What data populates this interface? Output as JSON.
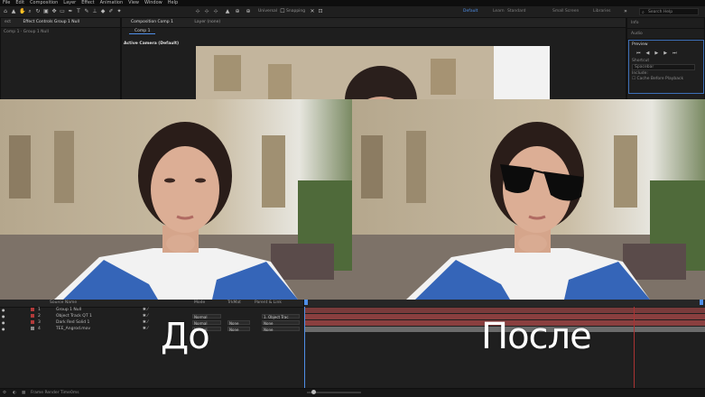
{
  "menu": [
    "File",
    "Edit",
    "Composition",
    "Layer",
    "Effect",
    "Animation",
    "View",
    "Window",
    "Help"
  ],
  "toolbar": {
    "universal_label": "Universal",
    "snapping_label": "Snapping",
    "workspaces": [
      "Default",
      "Learn",
      "Standard",
      "Small Screen",
      "Libraries"
    ],
    "active_workspace": "Default",
    "search_placeholder": "Search Help"
  },
  "left_panel": {
    "tabs": [
      "ect",
      "Effect Controls Group 1 Null"
    ],
    "breadcrumb": "Comp 1 · Group 1 Null"
  },
  "comp_panel": {
    "tabs": [
      "Composition Comp 1",
      "Layer (none)"
    ],
    "subtab": "Comp 1",
    "active_camera": "Active Camera (Default)"
  },
  "right_panel": {
    "info_tab": "Info",
    "audio_tab": "Audio",
    "preview_title": "Preview",
    "shortcut_label": "Shortcut",
    "shortcut_value": "Spacebar",
    "include_label": "Include:",
    "cache_label": "Cache Before Playback"
  },
  "comparison": {
    "before_label": "До",
    "after_label": "После"
  },
  "timeline": {
    "col_source": "Source Name",
    "col_mode": "Mode",
    "col_trkmat": "TrkMat",
    "col_parent": "Parent & Link",
    "layers": [
      {
        "num": "1",
        "name": "Group 1 Null",
        "color": "#b23a3a",
        "mode": "",
        "trkmat": "",
        "parent": ""
      },
      {
        "num": "2",
        "name": "Object Track QT 1",
        "color": "#b23a3a",
        "mode": "Normal",
        "trkmat": "",
        "parent": "1. Object Trac"
      },
      {
        "num": "3",
        "name": "Dark Red Solid 1",
        "color": "#b23a3a",
        "mode": "Normal",
        "trkmat": "None",
        "parent": "None"
      },
      {
        "num": "4",
        "name": "TEE_Angrod.mov",
        "color": "#8a8a8a",
        "mode": "Normal",
        "trkmat": "None",
        "parent": "None"
      }
    ],
    "track_colors": [
      "#7a3b3b",
      "#8a3f3f",
      "#8a3f3f",
      "#6b6b6b"
    ]
  },
  "status": {
    "frame_render_label": "Frame Render Time",
    "frame_render_value": "0ms"
  }
}
